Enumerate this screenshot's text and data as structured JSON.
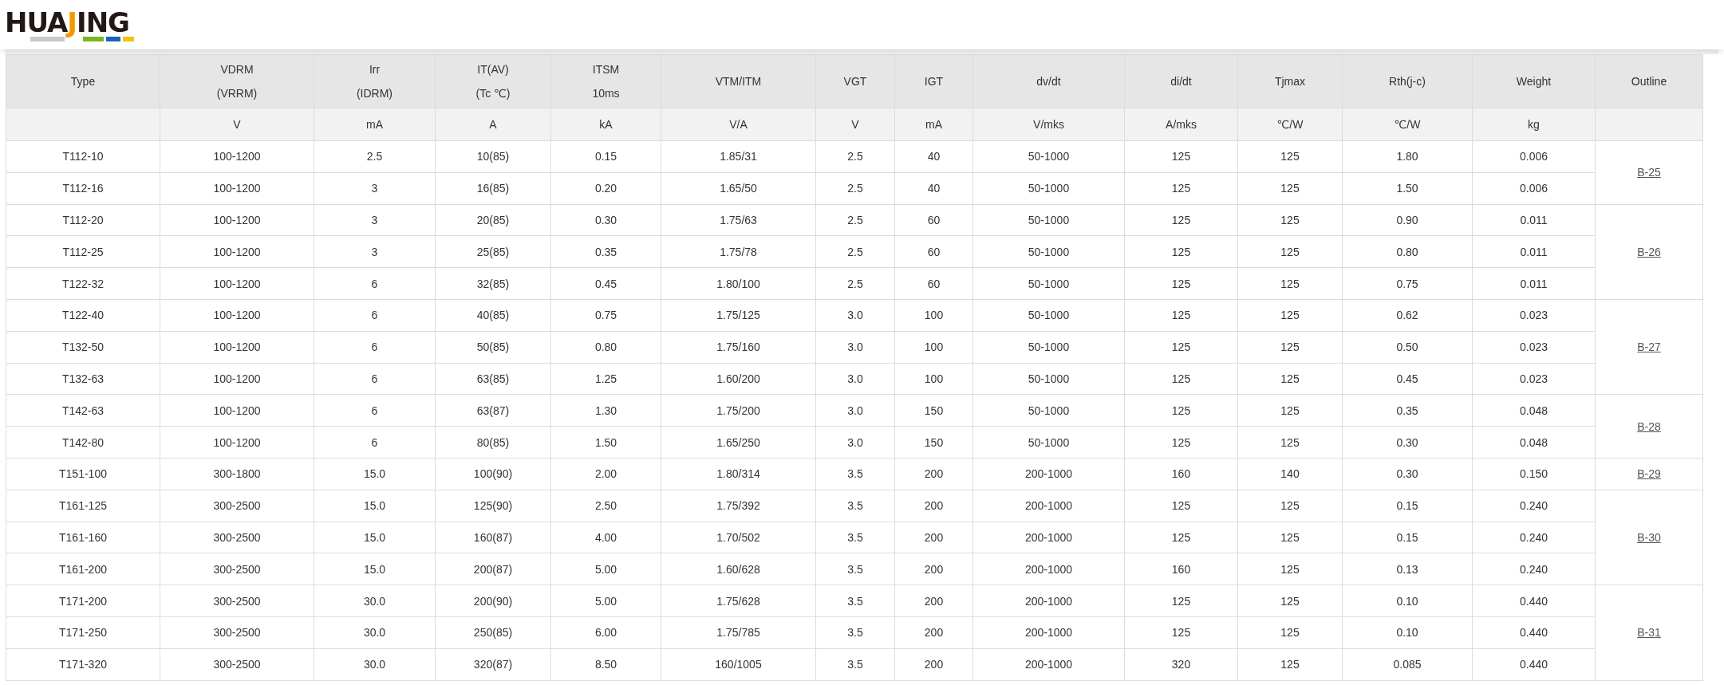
{
  "logo": {
    "parts": [
      "HUA",
      "J",
      "ING"
    ]
  },
  "table": {
    "columns": [
      {
        "lines": [
          "Type"
        ]
      },
      {
        "lines": [
          "VDRM",
          "(VRRM)"
        ],
        "unit": "V"
      },
      {
        "lines": [
          "Irr",
          "(IDRM)"
        ],
        "unit": "mA"
      },
      {
        "lines": [
          "IT(AV)",
          "(Tc ℃)"
        ],
        "unit": "A"
      },
      {
        "lines": [
          "ITSM",
          "10ms"
        ],
        "unit": "kA"
      },
      {
        "lines": [
          "VTM/ITM"
        ],
        "unit": "V/A"
      },
      {
        "lines": [
          "VGT"
        ],
        "unit": "V"
      },
      {
        "lines": [
          "IGT"
        ],
        "unit": "mA"
      },
      {
        "lines": [
          "dv/dt"
        ],
        "unit": "V/mks"
      },
      {
        "lines": [
          "di/dt"
        ],
        "unit": "A/mks"
      },
      {
        "lines": [
          "Tjmax"
        ],
        "unit": "℃/W"
      },
      {
        "lines": [
          "Rth(j-c)"
        ],
        "unit": "℃/W"
      },
      {
        "lines": [
          "Weight"
        ],
        "unit": "kg"
      },
      {
        "lines": [
          "Outline"
        ]
      }
    ],
    "groups": [
      {
        "outline": "B-25",
        "rows": [
          [
            "T112-10",
            "100-1200",
            "2.5",
            "10(85)",
            "0.15",
            "1.85/31",
            "2.5",
            "40",
            "50-1000",
            "125",
            "125",
            "1.80",
            "0.006"
          ],
          [
            "T112-16",
            "100-1200",
            "3",
            "16(85)",
            "0.20",
            "1.65/50",
            "2.5",
            "40",
            "50-1000",
            "125",
            "125",
            "1.50",
            "0.006"
          ]
        ]
      },
      {
        "outline": "B-26",
        "rows": [
          [
            "T112-20",
            "100-1200",
            "3",
            "20(85)",
            "0.30",
            "1.75/63",
            "2.5",
            "60",
            "50-1000",
            "125",
            "125",
            "0.90",
            "0.011"
          ],
          [
            "T112-25",
            "100-1200",
            "3",
            "25(85)",
            "0.35",
            "1.75/78",
            "2.5",
            "60",
            "50-1000",
            "125",
            "125",
            "0.80",
            "0.011"
          ],
          [
            "T122-32",
            "100-1200",
            "6",
            "32(85)",
            "0.45",
            "1.80/100",
            "2.5",
            "60",
            "50-1000",
            "125",
            "125",
            "0.75",
            "0.011"
          ]
        ]
      },
      {
        "outline": "B-27",
        "rows": [
          [
            "T122-40",
            "100-1200",
            "6",
            "40(85)",
            "0.75",
            "1.75/125",
            "3.0",
            "100",
            "50-1000",
            "125",
            "125",
            "0.62",
            "0.023"
          ],
          [
            "T132-50",
            "100-1200",
            "6",
            "50(85)",
            "0.80",
            "1.75/160",
            "3.0",
            "100",
            "50-1000",
            "125",
            "125",
            "0.50",
            "0.023"
          ],
          [
            "T132-63",
            "100-1200",
            "6",
            "63(85)",
            "1.25",
            "1.60/200",
            "3.0",
            "100",
            "50-1000",
            "125",
            "125",
            "0.45",
            "0.023"
          ]
        ]
      },
      {
        "outline": "B-28",
        "rows": [
          [
            "T142-63",
            "100-1200",
            "6",
            "63(87)",
            "1.30",
            "1.75/200",
            "3.0",
            "150",
            "50-1000",
            "125",
            "125",
            "0.35",
            "0.048"
          ],
          [
            "T142-80",
            "100-1200",
            "6",
            "80(85)",
            "1.50",
            "1.65/250",
            "3.0",
            "150",
            "50-1000",
            "125",
            "125",
            "0.30",
            "0.048"
          ]
        ]
      },
      {
        "outline": "B-29",
        "rows": [
          [
            "T151-100",
            "300-1800",
            "15.0",
            "100(90)",
            "2.00",
            "1.80/314",
            "3.5",
            "200",
            "200-1000",
            "160",
            "140",
            "0.30",
            "0.150"
          ]
        ]
      },
      {
        "outline": "B-30",
        "rows": [
          [
            "T161-125",
            "300-2500",
            "15.0",
            "125(90)",
            "2.50",
            "1.75/392",
            "3.5",
            "200",
            "200-1000",
            "125",
            "125",
            "0.15",
            "0.240"
          ],
          [
            "T161-160",
            "300-2500",
            "15.0",
            "160(87)",
            "4.00",
            "1.70/502",
            "3.5",
            "200",
            "200-1000",
            "125",
            "125",
            "0.15",
            "0.240"
          ],
          [
            "T161-200",
            "300-2500",
            "15.0",
            "200(87)",
            "5.00",
            "1.60/628",
            "3.5",
            "200",
            "200-1000",
            "160",
            "125",
            "0.13",
            "0.240"
          ]
        ]
      },
      {
        "outline": "B-31",
        "rows": [
          [
            "T171-200",
            "300-2500",
            "30.0",
            "200(90)",
            "5.00",
            "1.75/628",
            "3.5",
            "200",
            "200-1000",
            "125",
            "125",
            "0.10",
            "0.440"
          ],
          [
            "T171-250",
            "300-2500",
            "30.0",
            "250(85)",
            "6.00",
            "1.75/785",
            "3.5",
            "200",
            "200-1000",
            "125",
            "125",
            "0.10",
            "0.440"
          ],
          [
            "T171-320",
            "300-2500",
            "30.0",
            "320(87)",
            "8.50",
            "160/1005",
            "3.5",
            "200",
            "200-1000",
            "320",
            "125",
            "0.085",
            "0.440"
          ]
        ]
      }
    ]
  }
}
